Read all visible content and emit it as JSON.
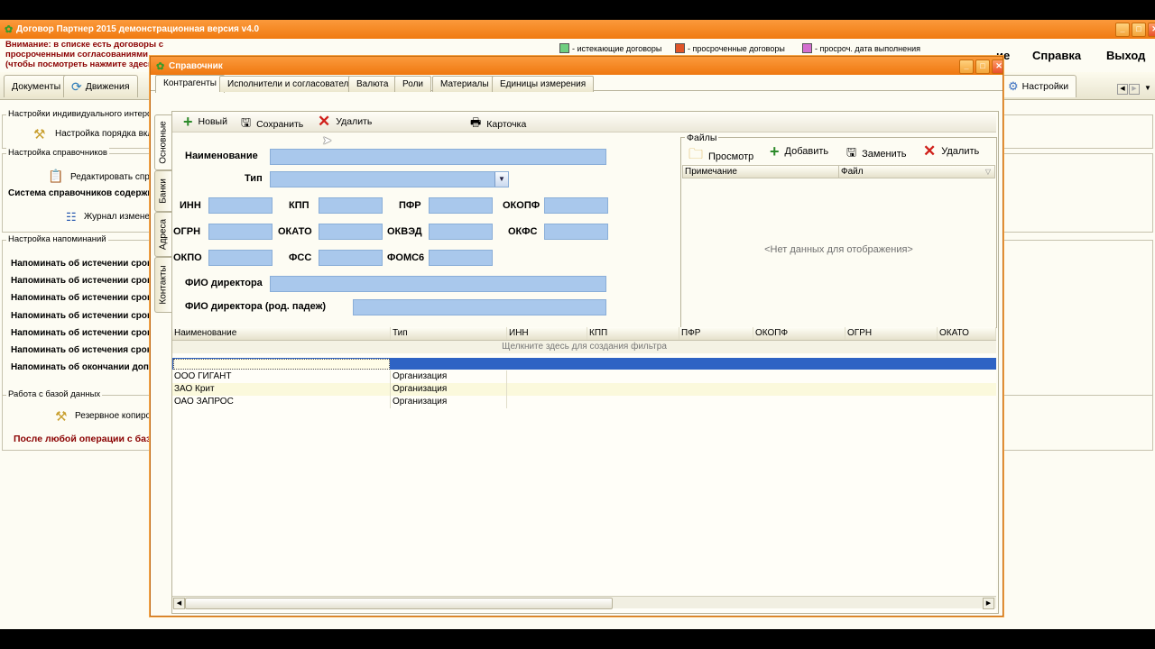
{
  "app": {
    "title": "Договор Партнер 2015 демонстрационная версия v4.0",
    "warning": "Внимание: в списке есть договоры с просроченными согласованиями (чтобы посмотреть нажмите здесь)",
    "legend": [
      {
        "label": "- истекающие договоры",
        "color": "#6fcf80"
      },
      {
        "label": "- просроченные договоры",
        "color": "#e0552a"
      },
      {
        "label": "- просроч. дата выполнения",
        "color": "#d46fd0"
      }
    ],
    "menu": {
      "m1": "ие",
      "help": "Справка",
      "exit": "Выход"
    },
    "tabs": {
      "docs": "Документы",
      "moves": "Движения",
      "settings": "Настройки"
    },
    "groups": {
      "ui": {
        "title": "Настройки индивидуального интерфей",
        "item": "Настройка порядка вклад"
      },
      "refs": {
        "title": "Настройка справочников",
        "edit": "Редактировать справ",
        "system": "Система справочников содержит",
        "journal": "Журнал изменени"
      },
      "remind": {
        "title": "Настройка напоминаний",
        "items": [
          "Напоминать об истечении срока",
          "Напоминать об истечении срока",
          "Напоминать об истечении срока",
          "Напоминать об истечении срока",
          "Напоминать об истечении срока",
          "Напоминать об истечения срока",
          "Напоминать об окончании доп. с"
        ]
      },
      "db": {
        "title": "Работа с базой данных",
        "backup": "Резервное копирова",
        "after": "После любой операции с базой"
      }
    }
  },
  "dialog": {
    "title": "Справочник",
    "tabs": [
      "Контрагенты",
      "Исполнители и согласователи",
      "Валюта",
      "Роли",
      "Материалы",
      "Единицы измерения"
    ],
    "vtabs": [
      "Основные",
      "Банки",
      "Адреса",
      "Контакты"
    ],
    "toolbar": {
      "new": "Новый",
      "save": "Сохранить",
      "delete": "Удалить",
      "card": "Карточка"
    },
    "form": {
      "name": "Наименование",
      "type": "Тип",
      "inn": "ИНН",
      "kpp": "КПП",
      "pfr": "ПФР",
      "okopf": "ОКОПФ",
      "ogrn": "ОГРН",
      "okato": "ОКАТО",
      "okved": "ОКВЭД",
      "okfs": "ОКФС",
      "okpo": "ОКПО",
      "fss": "ФСС",
      "foms": "ФОМС6",
      "director": "ФИО директора",
      "director_gen": "ФИО директора (род. падеж)"
    },
    "files": {
      "title": "Файлы",
      "view": "Просмотр",
      "add": "Добавить",
      "replace": "Заменить",
      "delete": "Удалить",
      "col_note": "Примечание",
      "col_file": "Файл",
      "empty": "<Нет данных для отображения>"
    },
    "grid": {
      "columns": [
        "Наименование",
        "Тип",
        "ИНН",
        "КПП",
        "ПФР",
        "ОКОПФ",
        "ОГРН",
        "ОКАТО"
      ],
      "filter_hint": "Щелкните здесь для создания фильтра",
      "rows": [
        [
          "ООО ГИГАНТ",
          "Организация"
        ],
        [
          "ЗАО Крит",
          "Организация"
        ],
        [
          "ОАО ЗАПРОС",
          "Организация"
        ]
      ]
    }
  }
}
